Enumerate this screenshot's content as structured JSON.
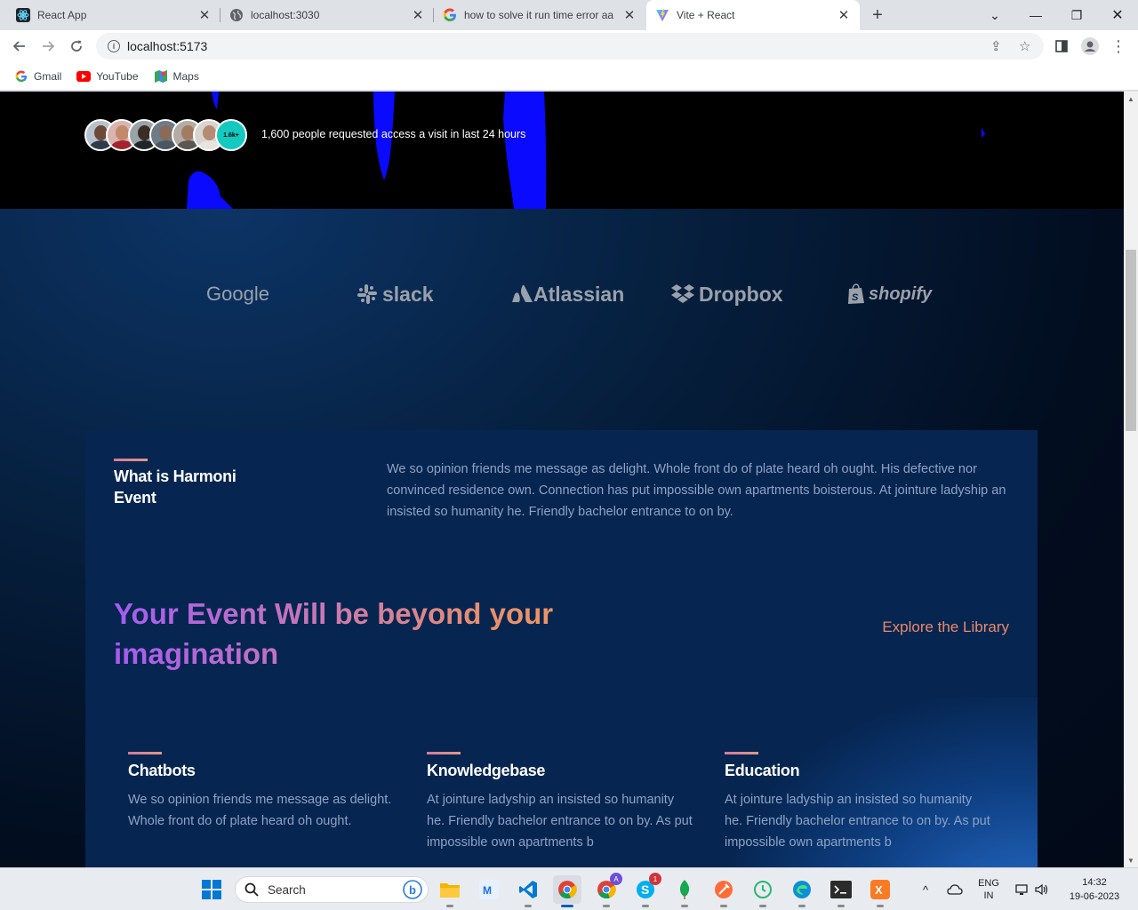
{
  "browser": {
    "tabs": [
      {
        "title": "React App",
        "icon": "react-icon",
        "active": false
      },
      {
        "title": "localhost:3030",
        "icon": "globe-icon",
        "active": false
      },
      {
        "title": "how to solve it run time error aa",
        "icon": "google-icon",
        "active": false
      },
      {
        "title": "Vite + React",
        "icon": "vite-icon",
        "active": true
      }
    ],
    "url": "localhost:5173",
    "bookmarks": [
      {
        "label": "Gmail",
        "icon": "google-icon"
      },
      {
        "label": "YouTube",
        "icon": "youtube-icon"
      },
      {
        "label": "Maps",
        "icon": "maps-icon"
      }
    ]
  },
  "hero": {
    "avatar_more": "1.6k+",
    "requests_text": "1,600 people requested access a visit in last 24 hours"
  },
  "brands": [
    "Google",
    "slack",
    "Atlassian",
    "Dropbox",
    "shopify"
  ],
  "about": {
    "title": "What is Harmoni Event",
    "text": "We so opinion friends me message as delight. Whole front do of plate heard oh ought. His defective nor convinced residence own. Connection has put impossible own apartments boisterous. At jointure ladyship an insisted so humanity he. Friendly bachelor entrance to on by."
  },
  "headline": {
    "text": "Your Event Will be beyond your imagination",
    "cta": "Explore the Library"
  },
  "features": [
    {
      "title": "Chatbots",
      "text": "We so opinion friends me message as delight. Whole front do of plate heard oh ought."
    },
    {
      "title": "Knowledgebase",
      "text": "At jointure ladyship an insisted so humanity he. Friendly bachelor entrance to on by. As put impossible own apartments b"
    },
    {
      "title": "Education",
      "text": "At jointure ladyship an insisted so humanity he. Friendly bachelor entrance to on by. As put impossible own apartments b"
    }
  ],
  "taskbar": {
    "search_label": "Search",
    "badges": {
      "chrome_profile": "A",
      "skype": "1"
    },
    "lang_primary": "ENG",
    "lang_secondary": "IN",
    "time": "14:32",
    "date": "19-06-2023"
  },
  "colors": {
    "panel": "#062550",
    "accent_gradient_start": "#a35cf0",
    "accent_gradient_end": "#f09a5c",
    "cta": "#ea8a6a"
  }
}
